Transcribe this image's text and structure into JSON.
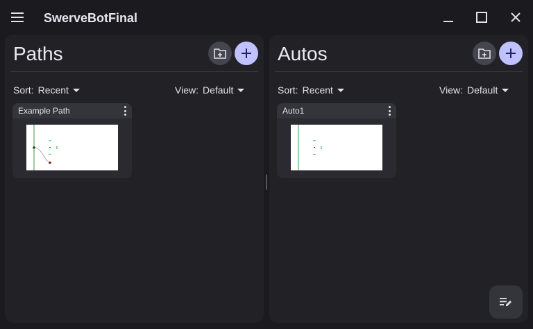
{
  "app": {
    "title": "SwerveBotFinal"
  },
  "window_controls": {
    "minimize_icon": "minimize-icon",
    "maximize_icon": "maximize-icon",
    "close_icon": "close-icon"
  },
  "paths_panel": {
    "title": "Paths",
    "sort_label": "Sort:",
    "sort_value": "Recent",
    "view_label": "View:",
    "view_value": "Default",
    "items": [
      {
        "name": "Example Path"
      }
    ]
  },
  "autos_panel": {
    "title": "Autos",
    "sort_label": "Sort:",
    "sort_value": "Recent",
    "view_label": "View:",
    "view_value": "Default",
    "items": [
      {
        "name": "Auto1"
      }
    ]
  },
  "colors": {
    "background": "#1b1b1f",
    "panel": "#212126",
    "accent_button": "#bfc2ff",
    "secondary_button": "#45454f",
    "card": "#2a2a30"
  }
}
